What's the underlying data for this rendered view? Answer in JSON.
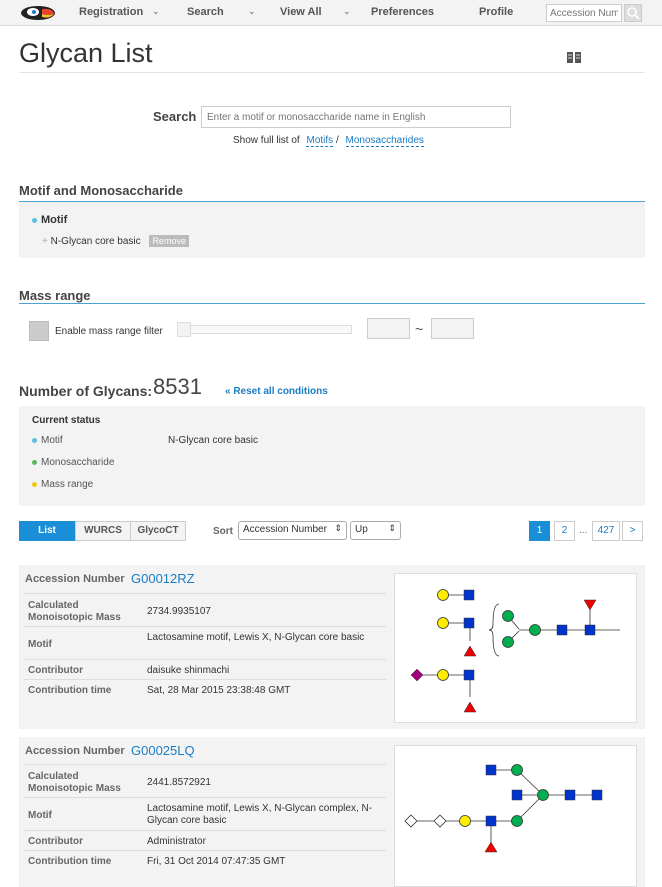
{
  "nav": {
    "items": [
      {
        "label": "Registration",
        "caret": "⌄"
      },
      {
        "label": "Search",
        "caret": "⌄"
      },
      {
        "label": "View All",
        "caret": "⌄"
      },
      {
        "label": "Preferences",
        "caret": ""
      },
      {
        "label": "Profile",
        "caret": ""
      }
    ],
    "search_placeholder": "Accession Num"
  },
  "page": {
    "title": "Glycan List"
  },
  "search": {
    "label": "Search",
    "placeholder": "Enter a motif or monosaccharide name in English",
    "show_full_prefix": "Show full list of",
    "motifs_link": "Motifs",
    "separator": "/",
    "monos_link": "Monosaccharides"
  },
  "motif_section": {
    "heading": "Motif and Monosaccharide",
    "motif_heading": "Motif",
    "motif_item": "N-Glycan core basic",
    "remove_label": "Remove"
  },
  "mass_section": {
    "heading": "Mass range",
    "enable_label": "Enable mass range filter",
    "tilde": "~"
  },
  "count": {
    "label": "Number of Glycans:",
    "value": "8531",
    "reset": "« Reset all conditions"
  },
  "status": {
    "title": "Current status",
    "rows": [
      {
        "label": "Motif",
        "value": "N-Glycan core basic",
        "color": "#5bc0de"
      },
      {
        "label": "Monosaccharide",
        "value": "",
        "color": "#5cb85c"
      },
      {
        "label": "Mass range",
        "value": "",
        "color": "#f0c419"
      }
    ]
  },
  "tabs": [
    "List",
    "WURCS",
    "GlycoCT"
  ],
  "sort": {
    "label": "Sort",
    "field": "Accession Number",
    "order": "Up"
  },
  "pagination": {
    "pages": [
      "1",
      "2"
    ],
    "ellipsis": "...",
    "last": "427",
    "next": ">"
  },
  "results": [
    {
      "acc_label": "Accession Number",
      "accession": "G00012RZ",
      "rows": [
        {
          "key": "Calculated Monoisotopic Mass",
          "value": "2734.9935107"
        },
        {
          "key": "Motif",
          "value": "Lactosamine motif, Lewis X, N-Glycan core basic"
        },
        {
          "key": "Contributor",
          "value": "daisuke shinmachi"
        },
        {
          "key": "Contribution time",
          "value": "Sat, 28 Mar 2015 23:38:48 GMT"
        }
      ]
    },
    {
      "acc_label": "Accession Number",
      "accession": "G00025LQ",
      "rows": [
        {
          "key": "Calculated Monoisotopic Mass",
          "value": "2441.8572921"
        },
        {
          "key": "Motif",
          "value": "Lactosamine motif, Lewis X, N-Glycan complex, N-Glycan core basic"
        },
        {
          "key": "Contributor",
          "value": "Administrator"
        },
        {
          "key": "Contribution time",
          "value": "Fri, 31 Oct 2014 07:47:35 GMT"
        }
      ]
    }
  ],
  "colors": {
    "accent": "#1a8fd8",
    "link": "#1a7dc4",
    "panel": "#f3f3f3",
    "rule": "#4aa3d8"
  },
  "icons": [
    "logo-icon",
    "search-icon",
    "book-icon",
    "chevron-down-icon"
  ]
}
